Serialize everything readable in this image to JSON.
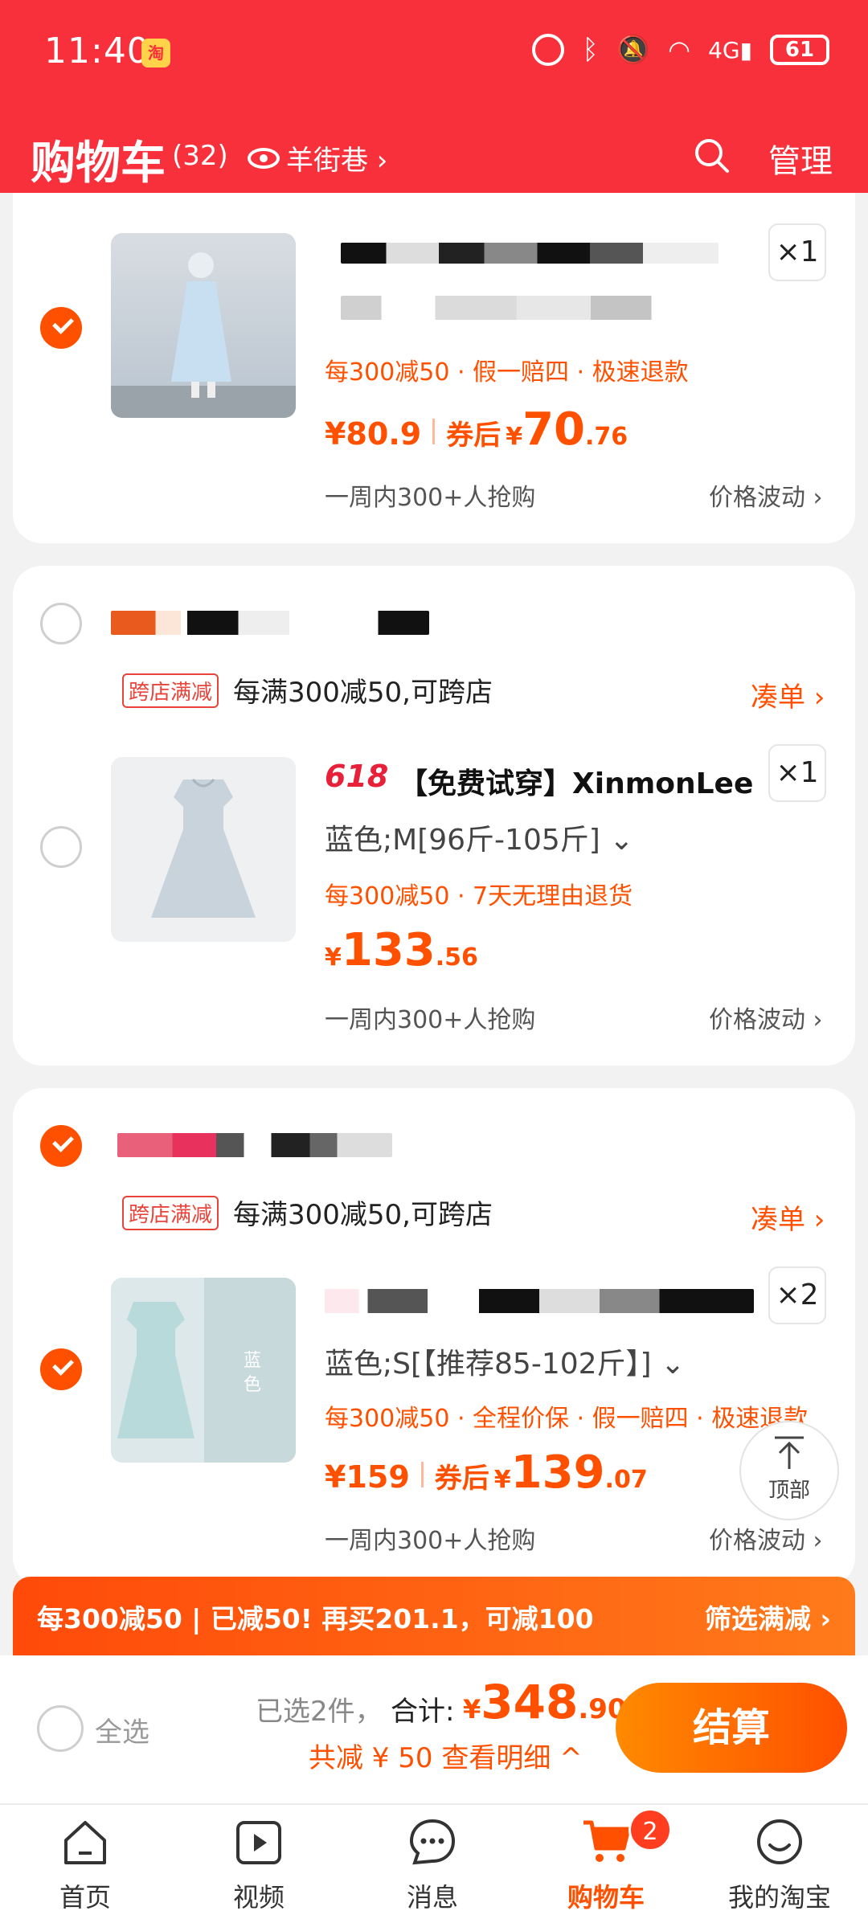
{
  "status": {
    "time": "11:40",
    "battery": "61"
  },
  "header": {
    "title": "购物车",
    "count": "(32)",
    "store": "羊街巷 ›",
    "manage": "管理"
  },
  "items": [
    {
      "qty": "×1",
      "promo": "每300减50 · 假一赔四 · 极速退款",
      "price": "¥80.9",
      "coupon_label": "券后",
      "coupon_yen": "¥",
      "coupon_int": "70",
      "coupon_dec": ".76",
      "meta_left": "一周内300+人抢购",
      "meta_right": "价格波动 ›"
    },
    {
      "tag": "跨店满减",
      "cross_text": "每满300减50,可跨店",
      "combine": "凑单 ›",
      "badge_618": "618",
      "title": "【免费试穿】XinmonLee",
      "qty": "×1",
      "sku": "蓝色;M[96斤-105斤] ⌄",
      "promo": "每300减50 · 7天无理由退货",
      "price_yen": "¥",
      "price_int": "133",
      "price_dec": ".56",
      "meta_left": "一周内300+人抢购",
      "meta_right": "价格波动 ›"
    },
    {
      "tag": "跨店满减",
      "cross_text": "每满300减50,可跨店",
      "combine": "凑单 ›",
      "qty": "×2",
      "sku": "蓝色;S[【推荐85-102斤】] ⌄",
      "promo": "每300减50 · 全程价保 · 假一赔四 · 极速退款",
      "price": "¥159",
      "coupon_label": "券后",
      "coupon_yen": "¥",
      "coupon_int": "139",
      "coupon_dec": ".07",
      "meta_left": "一周内300+人抢购",
      "meta_right": "价格波动 ›"
    }
  ],
  "back_to_top": "顶部",
  "banner": {
    "text": "每300减50 | 已减50!  再买201.1，可减100",
    "filter": "筛选满减 ›"
  },
  "checkout": {
    "select_all": "全选",
    "selected": "已选2件，",
    "total_label": "合计:",
    "total_yen": "¥",
    "total_int": "348",
    "total_dec": ".90",
    "saved": "共减 ¥ 50  查看明细 ^",
    "pay": "结算"
  },
  "tabs": [
    {
      "label": "首页",
      "icon": "home-icon"
    },
    {
      "label": "视频",
      "icon": "video-icon"
    },
    {
      "label": "消息",
      "icon": "message-icon"
    },
    {
      "label": "购物车",
      "icon": "cart-icon"
    },
    {
      "label": "我的淘宝",
      "icon": "profile-icon"
    }
  ],
  "cart_badge": "2",
  "colors": {
    "brand_red": "#f8303b",
    "accent_orange": "#ff5000"
  }
}
